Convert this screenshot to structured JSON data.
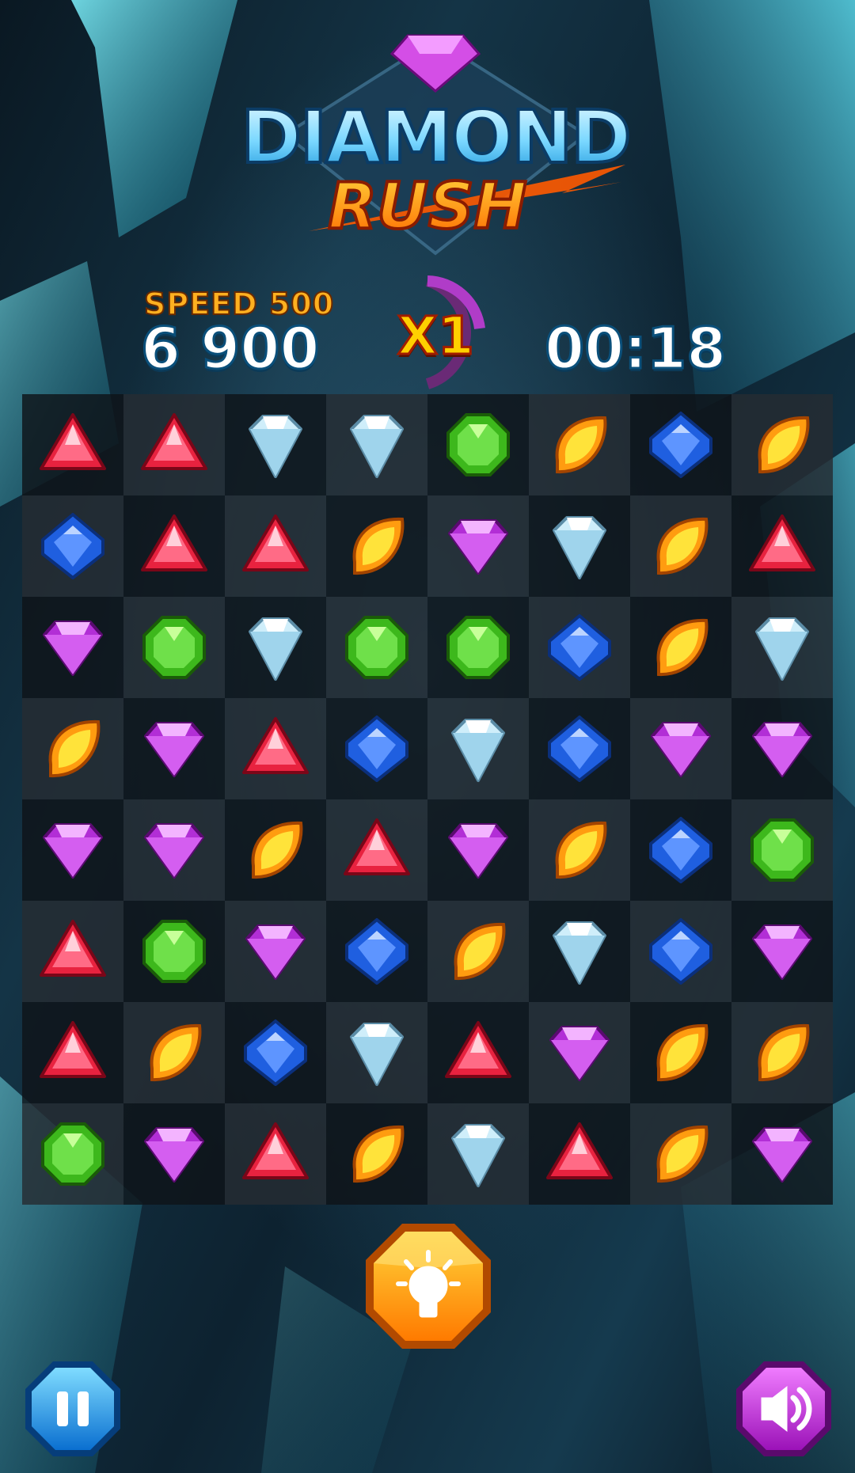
{
  "title": {
    "line1": "DIAMOND",
    "line2": "RUSH"
  },
  "hud": {
    "speed_label": "SPEED 500",
    "score": "6 900",
    "multiplier": "X1",
    "timer": "00:18"
  },
  "board": {
    "size": 8,
    "rows": [
      [
        "red",
        "red",
        "white",
        "white",
        "green",
        "orange",
        "blue",
        "orange"
      ],
      [
        "blue",
        "red",
        "red",
        "orange",
        "purple",
        "white",
        "orange",
        "red"
      ],
      [
        "purple",
        "green",
        "white",
        "green",
        "green",
        "blue",
        "orange",
        "white"
      ],
      [
        "orange",
        "purple",
        "red",
        "blue",
        "white",
        "blue",
        "purple",
        "purple"
      ],
      [
        "purple",
        "purple",
        "orange",
        "red",
        "purple",
        "orange",
        "blue",
        "green"
      ],
      [
        "red",
        "green",
        "purple",
        "blue",
        "orange",
        "white",
        "blue",
        "purple"
      ],
      [
        "red",
        "orange",
        "blue",
        "white",
        "red",
        "purple",
        "orange",
        "orange"
      ],
      [
        "green",
        "purple",
        "red",
        "orange",
        "white",
        "red",
        "orange",
        "purple"
      ]
    ]
  },
  "buttons": {
    "hint": "lightbulb-icon",
    "pause": "pause-icon",
    "sound": "sound-icon"
  },
  "colors": {
    "red": "#e8223f",
    "white": "#cfeefa",
    "green": "#3db81c",
    "orange": "#ff9c10",
    "blue": "#1f5fe0",
    "purple": "#b22ed6"
  }
}
